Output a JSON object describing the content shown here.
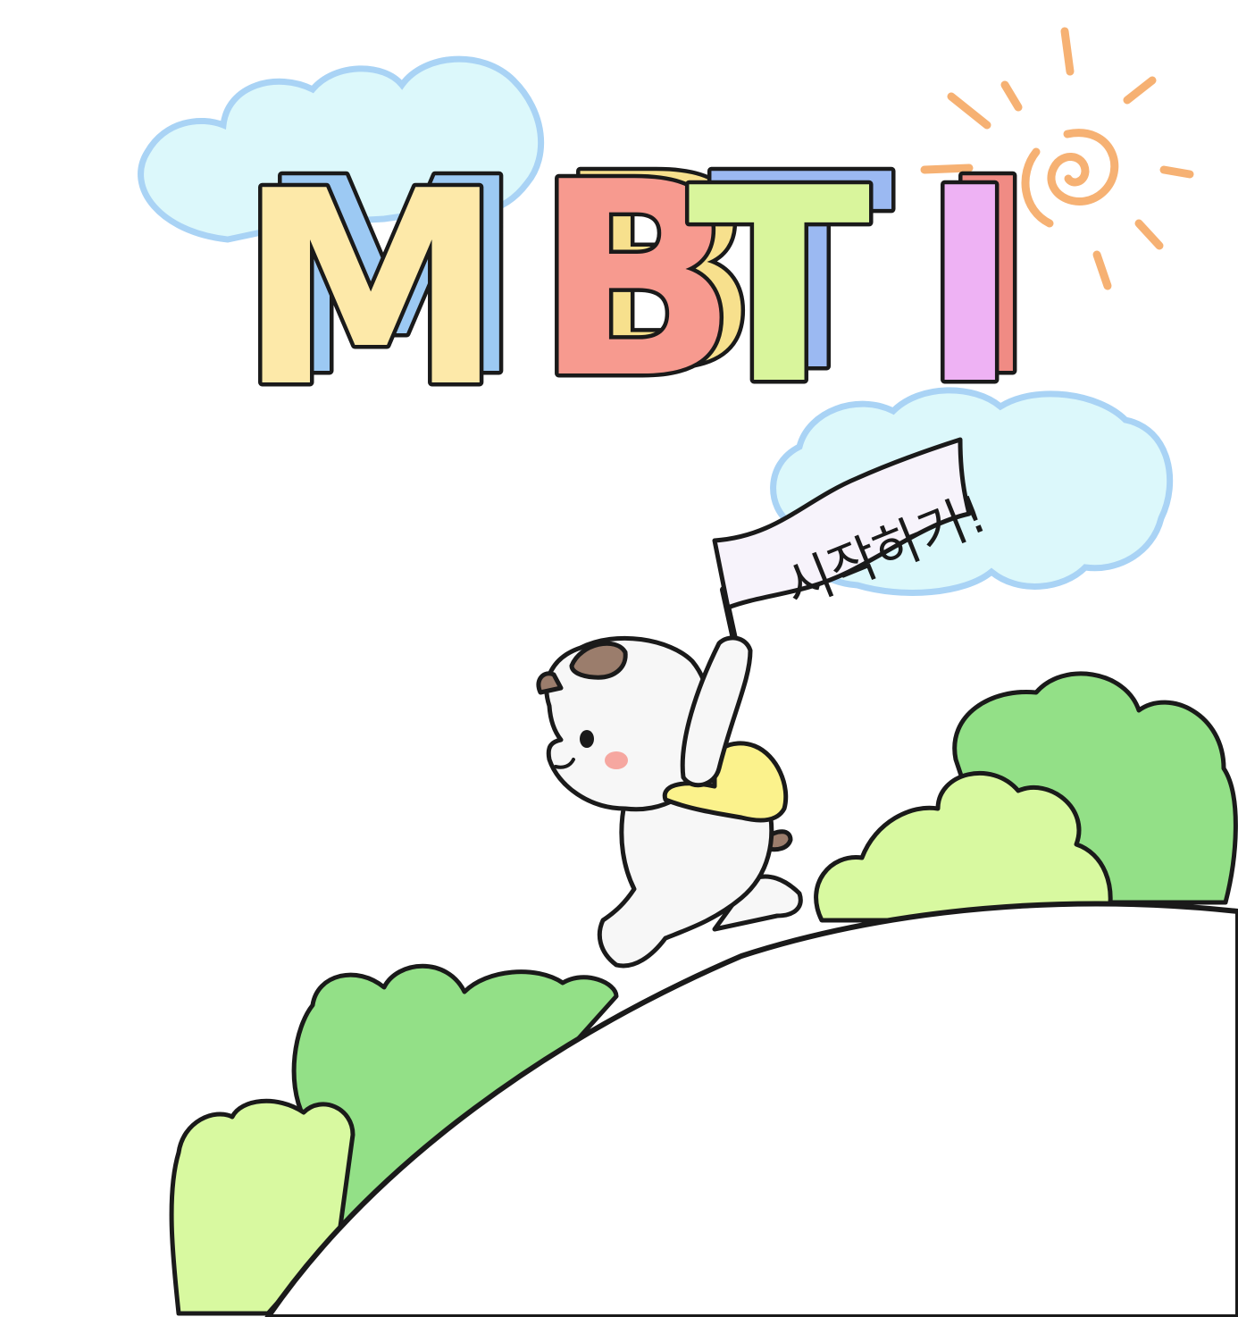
{
  "title": {
    "letters": [
      {
        "char": "M",
        "face_color": "#fde9a9",
        "depth_color": "#9cc9f3"
      },
      {
        "char": "B",
        "face_color": "#f79a8f",
        "depth_color": "#f7e08d"
      },
      {
        "char": "T",
        "face_color": "#d9f59c",
        "depth_color": "#9bb9f2"
      },
      {
        "char": "I",
        "face_color": "#eeb2f4",
        "depth_color": "#f08b84"
      }
    ]
  },
  "start_flag": {
    "label": "시작하기!"
  },
  "colors": {
    "cloud_fill": "#dcf8fb",
    "cloud_outline": "#a9d3f5",
    "sun": "#f6b173",
    "bush_dark": "#93e087",
    "bush_light": "#d8f9a0",
    "backpack": "#fbf28c",
    "character_body": "#f7f7f7",
    "character_spot": "#9b7d6c",
    "cheek": "#f6a7a0"
  },
  "icons": [
    "sun-icon",
    "cloud-icon",
    "character-icon",
    "flag-icon",
    "bush-icon",
    "hill-icon"
  ]
}
